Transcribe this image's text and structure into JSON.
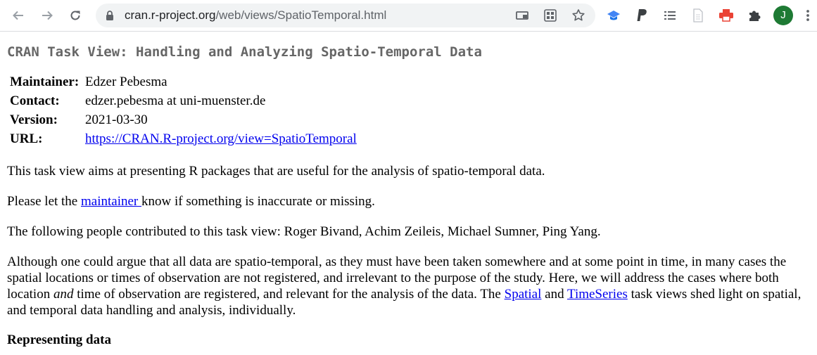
{
  "browser": {
    "url_domain": "cran.r-project.org",
    "url_path": "/web/views/SpatioTemporal.html",
    "profile_initial": "J",
    "icons": {
      "back": "back-arrow-icon",
      "forward": "forward-arrow-icon",
      "reload": "reload-icon",
      "lock": "lock-icon",
      "cast": "cast-icon",
      "qr": "qr-code-icon",
      "bookmark": "star-icon"
    },
    "extensions": [
      "graduation-cap-icon",
      "paypal-icon",
      "list-icon",
      "document-icon",
      "printer-icon",
      "puzzle-icon"
    ],
    "colors": {
      "toolbar_bg": "#ffffff",
      "omnibox_bg": "#f1f3f4",
      "avatar_bg": "#1e7a34"
    }
  },
  "page": {
    "title": "CRAN Task View: Handling and Analyzing Spatio-Temporal Data",
    "meta": {
      "maintainer_label": "Maintainer:",
      "maintainer_value": "Edzer Pebesma",
      "contact_label": "Contact:",
      "contact_value": "edzer.pebesma at uni-muenster.de",
      "version_label": "Version:",
      "version_value": "2021-03-30",
      "url_label": "URL:",
      "url_value": "https://CRAN.R-project.org/view=SpatioTemporal"
    },
    "intro": "This task view aims at presenting R packages that are useful for the analysis of spatio-temporal data.",
    "feedback_before": "Please let the ",
    "feedback_link": "maintainer ",
    "feedback_after": "know if something is inaccurate or missing.",
    "contributors": "The following people contributed to this task view: Roger Bivand, Achim Zeileis, Michael Sumner, Ping Yang.",
    "body_1": "Although one could argue that all data are spatio-temporal, as they must have been taken somewhere and at some point in time, in many cases the spatial locations or times of observation are not registered, and irrelevant to the purpose of the study. Here, we will address the cases where both location ",
    "body_em": "and",
    "body_2": " time of observation are registered, and relevant for the analysis of the data. The ",
    "spatial_link": "Spatial",
    "body_3": " and ",
    "timeseries_link": "TimeSeries",
    "body_4": " task views shed light on spatial, and temporal data handling and analysis, individually.",
    "section_heading": "Representing data"
  }
}
